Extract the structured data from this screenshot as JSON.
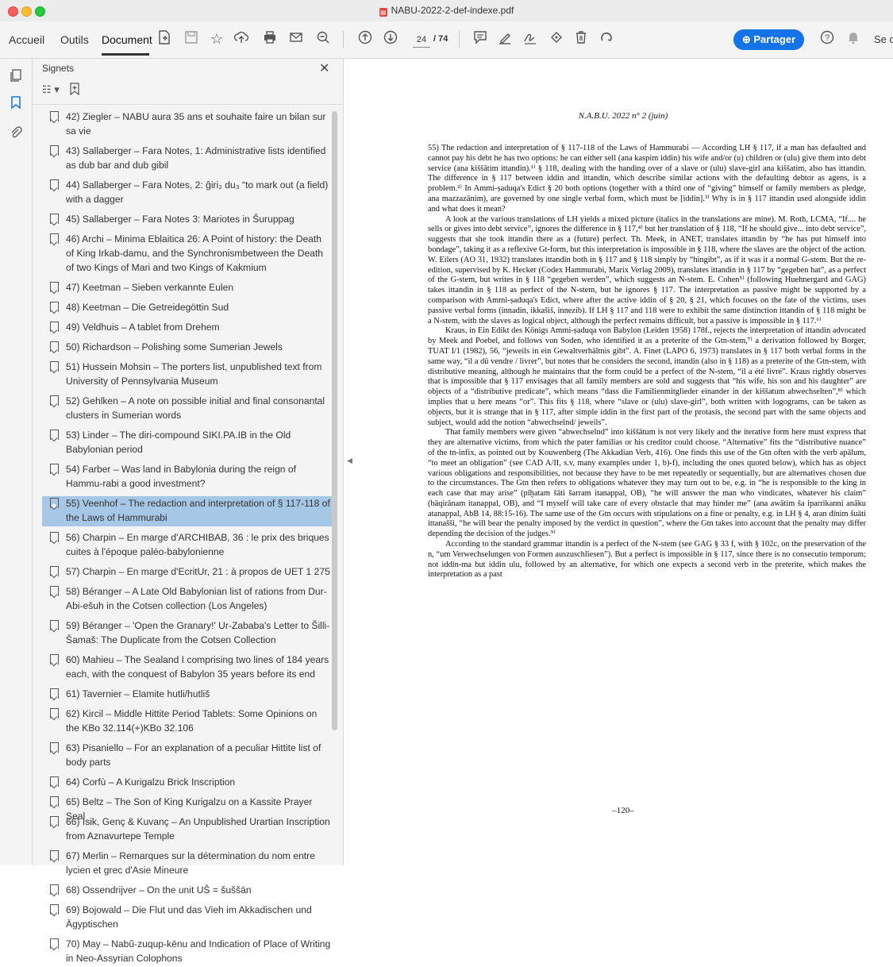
{
  "window": {
    "title": "NABU-2022-2-def-indexe.pdf"
  },
  "toolbar": {
    "menu": [
      "Accueil",
      "Outils",
      "Document"
    ],
    "page_current": "24",
    "page_total": "/ 74",
    "share_label": "Partager",
    "sign_in_partial": "Se c",
    "icons": [
      "file-add-icon",
      "save-icon",
      "star-icon",
      "upload-icon",
      "print-icon",
      "mail-icon",
      "zoom-icon",
      "arrow-up-icon",
      "arrow-down-icon",
      "comment-icon",
      "highlight-icon",
      "sign-icon",
      "stamp-icon",
      "trash-icon",
      "rotate-icon",
      "help-icon",
      "bell-icon"
    ]
  },
  "panel": {
    "title": "Signets",
    "items": [
      "42) Ziegler – NABU aura 35 ans et souhaite faire un bilan sur sa vie",
      "43) Sallaberger – Fara Notes, 1: Administrative lists identified as dub bar and dub gibil",
      "44) Sallaberger – Fara Notes, 2: ĝiri₂ du₃ “to mark out (a field) with a dagger",
      "45) Sallaberger – Fara Notes 3: Mariotes in Šuruppag",
      "46) Archi – Minima Eblaitica 26: A Point of history: the Death of King Irkab-damu, and the Synchronismbetween the Death of two Kings of Mari and two Kings of Kakmium",
      "47) Keetman – Sieben verkannte Eulen",
      "48) Keetman – Die Getreidegöttin Sud",
      "49) Veldhuis – A tablet from Drehem",
      "50) Richardson – Polishing some Sumerian Jewels",
      "51) Hussein Mohsin – The porters list, unpublished text from University of Pennsylvania Museum",
      "52) Gehlken – A note on possible initial and final consonantal clusters in Sumerian words",
      "53) Linder – The diri-compound SIKI.PA.IB in the Old Babylonian period",
      "54) Farber – Was land in Babylonia during the reign of Hammu-rabi a good investment?",
      "55) Veenhof – The redaction and interpretation of § 117-118 of the Laws of Hammurabi",
      "56) Charpin – En marge d'ARCHIBAB, 36 : le prix des briques cuites à l'époque paléo-babylonienne",
      "57) Charpin – En marge d'EcritUr, 21 : à propos de UET 1 275",
      "58) Béranger – A Late Old Babylonian list of rations from Dur-Abi-ešuh in the Cotsen collection (Los Angeles)",
      "59) Béranger – 'Open the Granary!' Ur-Zababa's Letter to Šilli-Šamaš: The Duplicate from the Cotsen Collection",
      "60) Mahieu – The Sealand I comprising two lines of 184 years each, with the conquest of Babylon 35 years before its end",
      "61) Tavernier – Elamite hutli/hutliš",
      "62) Kircil – Middle Hittite Period Tablets: Some Opinions on the KBo 32.114(+)KBo 32.106",
      "63) Pisaniello – For an explanation of a peculiar Hittite list of body parts",
      "64) Corfù – A Kurigalzu Brick Inscription",
      "65) Beltz – The Son of King Kurigalzu on a Kassite Prayer Seal",
      "66) Isik, Genç & Kuvanç – An Unpublished Urartian Inscription from Aznavurtepe Temple",
      "67) Merlin – Remarques sur la détermination du nom entre lycien et grec d'Asie Mineure",
      "68) Ossendrijver – On the unit UŠ = šuššān",
      "69) Bojowald – Die Flut und das Vieh im Akkadischen und Ägyptischen",
      "70) May – Nabû-zuqup-kēnu and Indication of Place of Writing in Neo-Assyrian Colophons"
    ]
  },
  "document": {
    "header": "N.A.B.U. 2022 n° 2 (juin)",
    "paragraphs": [
      "55) The redaction and interpretation of § 117-118 of the Laws of Hammurabi — According LH § 117, if a man has defaulted and cannot pay his debt he has two options: he can either sell (ana kaspim iddin) his wife and/or (u) children or (ulu) give them into debt service (ana kiššātim ittandin).¹⁾ § 118, dealing with the handing over of a slave or (ulu) slave-girl ana kiššatim, also has ittandin. The difference in § 117 between iddin and ittandin, which describe similar actions with the defaulting debtor as agens, is a problem.²⁾ In Ammi-ṣaduqa's Edict § 20 both options (together with a third one of “giving” himself or family members as pledge, ana mazzazānim), are governed by one single verbal form, which must be [iddin].³⁾ Why is in § 117 ittandin used alongside iddin and what does it mean?",
      "A look at the various translations of LH yields a mixed picture (italics in the translations are mine). M. Roth, LCMA, “If.... he sells or gives into debt service”, ignores the difference in § 117,⁴⁾ but her translation of § 118, “If he should give... into debt service”, suggests that she took ittandin there as a (future) perfect. Th. Meek, in ANET, translates ittandin by “he has put himself into bondage”, taking it as a reflexive Gt-form, but this interpretation is impossible in § 118, where the slaves are the object of the action. W. Eilers (AO 31, 1932) translates ittandin both in § 117 and § 118 simply by “hingibt”, as if it was it a normal G-stem. But the re-edition, supervised by K. Hecker (Codex Hammurabi, Marix Verlag 2009), translates ittandin in § 117 by “gegeben hat”, as a perfect of the G-stem, but writes in § 118 “gegeben werden”, which suggests an N-stem. E. Cohen⁵⁾ (following Huehnergard and GAG) takes ittandin in § 118 as perfect of the N-stem, but he ignores § 117. The interpretation as passive might be supported by a comparison with Ammi-ṣaduqa's Edict, where after the active iddin of § 20, § 21, which focuses on the fate of the victims, uses passive verbal forms (innadin, ikkašiš, innezib). If LH § 117 and 118 were to exhibit the same distinction ittandin of § 118 might be a N-stem, with the slaves as logical object, although the perfect remains difficult, but a passive is impossible in § 117.⁶⁾",
      "Kraus, in Ein Edikt des Königs Ammi-ṣaduqa von Babylon (Leiden 1958) 178f., rejects the interpretation of ittandin advocated by Meek and Poebel, and follows von Soden, who identified it as a preterite of the Gtn-stem,⁷⁾ a derivation followed by Borger, TUAT I/1 (1982), 56, “jeweils in ein Gewaltverhältnis gibt”. A. Finet (LAPO 6, 1973) translates in § 117 both verbal forms in the same way, “il a dû vendre / livrer”, but notes that he considers the second, ittandin (also in § 118) as a preterite of the Gtn-stem, with distributive meaning, although he maintains that the form could be a perfect of the N-stem, “il a été livré”. Kraus rightly observes that is impossible that § 117 envisages that all family members are sold and suggests that “his wife, his son and his daughter” are objects of a “distributive predicate”, which means “dass die Familienmitglieder einander in der kiššatum abwechselten”,⁸⁾ which implies that u here means “or”. This fits § 118, where “slave or (ulu) slave-girl”, both written with logograms, can be taken as objects, but it is strange that in § 117, after simple iddin in the first part of the protasis, the second part with the same objects and subject, would add the notion “abwechselnd/ jeweils”.",
      "That family members were given “abwechselnd” into kiššātum is not very likely and the iterative form here must express that they are alternative victims, from which the pater familias or his creditor could choose. “Alternative” fits the “distributive nuance” of the tn-infix, as pointed out by Kouwenberg (The Akkadian Verb, 416). One finds this use of the Gtn often with the verb apālum, “to meet an obligation” (see CAD A/II, s.v, many examples under 1, b)-f), including the ones quoted below), which has as object various obligations and responsibilities, not because they have to be met repeatedly or sequentially, but are alternatives chosen due to the circumstances. The Gtn then refers to obligations whatever they may turn out to be, e.g. in “he is responsible to the king in each case that may arise” (pīḫatam šāti šarram itanappal, OB), “he will answer the man who vindicates, whatever his claim” (bāqirānam itanappal, OB), and “I myself will take care of every obstacle that may hinder me” (ana awātim ša iparrikanni anāku atanappal, AbB 14, 88:15-16). The same use of the Gtn occurs with stipulations on a fine or penalty, e.g. in LH § 4, aran dīnim šuāti ittanašši, “he will bear the penalty imposed by the verdict in question”, where the Gtn takes into account that the penalty may differ depending the decision of the judges.⁹⁾",
      "According to the standard grammar ittandin is a perfect of the N-stem (see GAG § 33 f, with § 102c, on the preservation of the n, “um Verwechselungen von Formen auszuschliesen”). But a perfect is impossible in § 117, since there is no consecutio temporum; not iddin-ma but iddin ulu, followed by an alternative, for which one expects a second verb in the preterite, which makes the interpretation as a past"
    ],
    "page_number": "–120–"
  }
}
